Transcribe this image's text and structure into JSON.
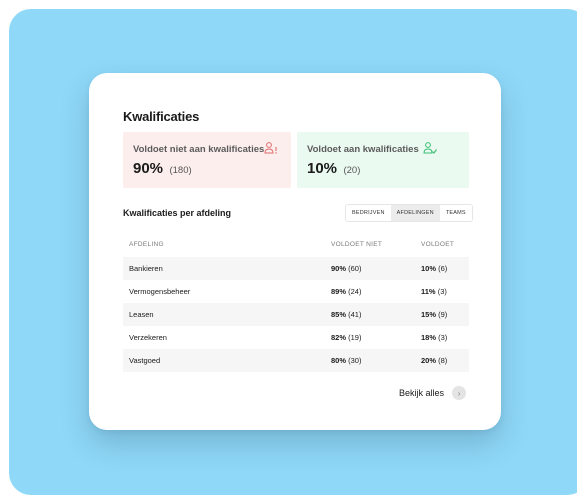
{
  "card": {
    "title": "Kwalificaties",
    "stats": {
      "not_met": {
        "label": "Voldoet niet aan kwalificaties",
        "percent": "90%",
        "count": "(180)",
        "icon": "user-warning-icon",
        "accent": "#e06b6b",
        "background": "#fdeeee"
      },
      "met": {
        "label": "Voldoet aan kwalificaties",
        "percent": "10%",
        "count": "(20)",
        "icon": "user-check-icon",
        "accent": "#3bbf73",
        "background": "#eafaf0"
      }
    },
    "section_title": "Kwalificaties per afdeling",
    "segmented": {
      "options": [
        "BEDRIJVEN",
        "AFDELINGEN",
        "TEAMS"
      ],
      "selected": "AFDELINGEN"
    },
    "table": {
      "headers": [
        "AFDELING",
        "VOLDOET NIET",
        "VOLDOET"
      ],
      "rows": [
        {
          "afdeling": "Bankieren",
          "niet_pct": "90%",
          "niet_count": "(60)",
          "wel_pct": "10%",
          "wel_count": "(6)"
        },
        {
          "afdeling": "Vermogensbeheer",
          "niet_pct": "89%",
          "niet_count": "(24)",
          "wel_pct": "11%",
          "wel_count": "(3)"
        },
        {
          "afdeling": "Leasen",
          "niet_pct": "85%",
          "niet_count": "(41)",
          "wel_pct": "15%",
          "wel_count": "(9)"
        },
        {
          "afdeling": "Verzekeren",
          "niet_pct": "82%",
          "niet_count": "(19)",
          "wel_pct": "18%",
          "wel_count": "(3)"
        },
        {
          "afdeling": "Vastgoed",
          "niet_pct": "80%",
          "niet_count": "(30)",
          "wel_pct": "20%",
          "wel_count": "(8)"
        }
      ]
    },
    "view_all": {
      "label": "Bekijk alles",
      "icon": "chevron-right-icon"
    }
  },
  "colors": {
    "backdrop": "#8fd8f7",
    "card": "#ffffff"
  }
}
